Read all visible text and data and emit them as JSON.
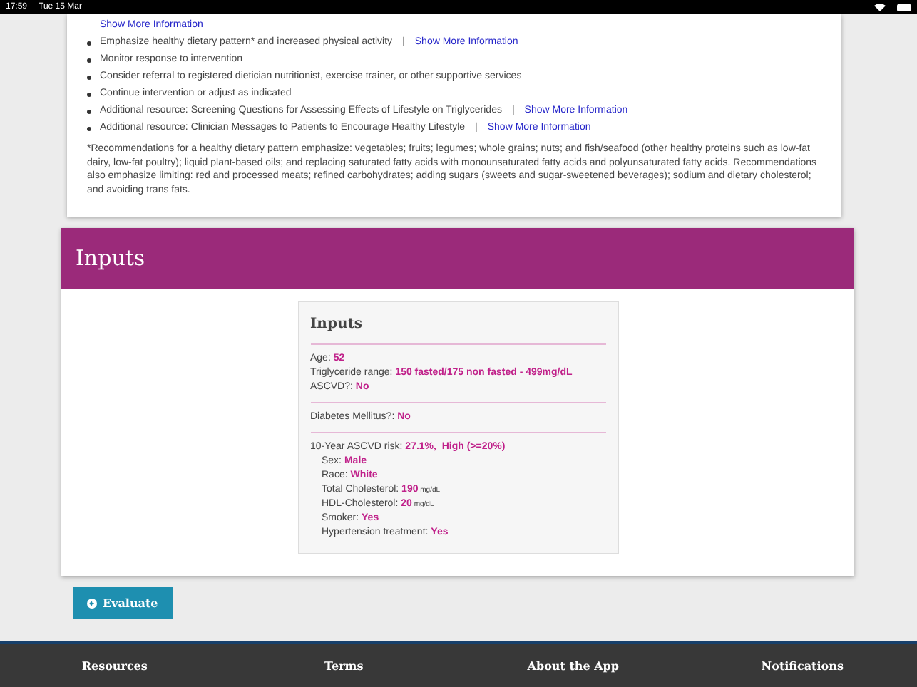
{
  "status_bar": {
    "time": "17:59",
    "date": "Tue 15 Mar"
  },
  "recommendations": {
    "lead_link": "Show More Information",
    "items": [
      {
        "text": "Emphasize healthy dietary pattern* and increased physical activity",
        "separator": "|",
        "link": "Show More Information"
      },
      {
        "text": "Monitor response to intervention"
      },
      {
        "text": "Consider referral to registered dietician nutritionist, exercise trainer, or other supportive services"
      },
      {
        "text": "Continue intervention or adjust as indicated"
      },
      {
        "text": "Additional resource: Screening Questions for Assessing Effects of Lifestyle on Triglycerides",
        "separator": "|",
        "link": "Show More Information"
      },
      {
        "text": "Additional resource: Clinician Messages to Patients to Encourage Healthy Lifestyle",
        "separator": "|",
        "link": "Show More Information"
      }
    ],
    "footnote": "*Recommendations for a healthy dietary pattern emphasize: vegetables; fruits; legumes; whole grains; nuts; and fish/seafood (other healthy proteins such as low-fat dairy, low-fat poultry); liquid plant-based oils; and replacing saturated fatty acids with monounsaturated fatty acids and polyunsaturated fatty acids. Recommendations also emphasize limiting: red and processed meats; refined carbohydrates; adding sugars (sweets and sugar-sweetened beverages); sodium and dietary cholesterol; and avoiding trans fats."
  },
  "inputs_panel": {
    "title": "Inputs",
    "card_title": "Inputs",
    "sections": [
      [
        {
          "label": "Age:",
          "value": "52"
        },
        {
          "label": "Triglyceride range:",
          "value": "150 fasted/175 non fasted - 499mg/dL"
        },
        {
          "label": "ASCVD?:",
          "value": "No"
        }
      ],
      [
        {
          "label": "Diabetes Mellitus?:",
          "value": "No"
        }
      ],
      [
        {
          "label": "10-Year ASCVD risk:",
          "value": "27.1%,  High (>=20%)",
          "children": [
            {
              "label": "Sex:",
              "value": "Male"
            },
            {
              "label": "Race:",
              "value": "White"
            },
            {
              "label": "Total Cholesterol:",
              "value": "190",
              "unit": "mg/dL"
            },
            {
              "label": "HDL-Cholesterol:",
              "value": "20",
              "unit": "mg/dL"
            },
            {
              "label": "Smoker:",
              "value": "Yes"
            },
            {
              "label": "Hypertension treatment:",
              "value": "Yes"
            }
          ]
        }
      ]
    ]
  },
  "evaluate_button": "Evaluate",
  "footer": [
    "Resources",
    "Terms",
    "About the App",
    "Notifications"
  ]
}
